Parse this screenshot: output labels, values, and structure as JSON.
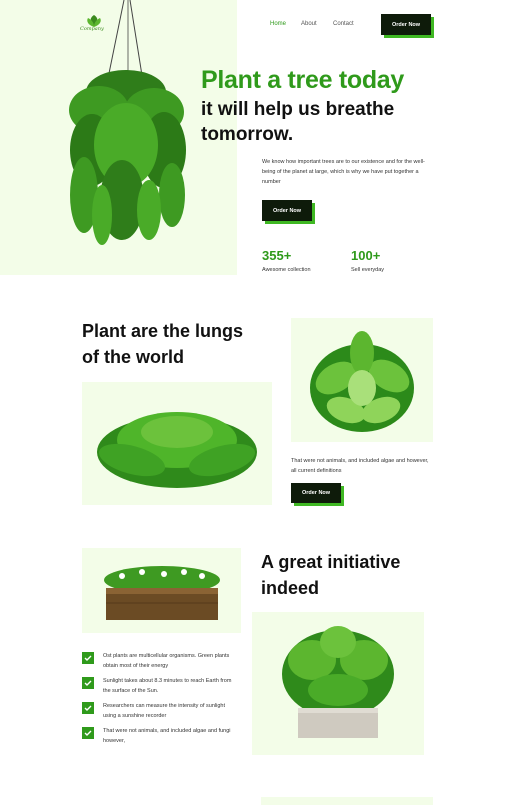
{
  "brand": {
    "logo_text": "Company"
  },
  "nav": {
    "home": "Home",
    "about": "About",
    "contact": "Contact",
    "cta": "Order Now"
  },
  "hero": {
    "title_highlight": "Plant a tree today",
    "title_rest": "it will help us breathe tomorrow.",
    "description": "We know how important trees are to our existence and for the well-being of the planet at large, which is why we have put together a number",
    "cta": "Order Now",
    "stats": [
      {
        "value": "355+",
        "label": "Awesome collection"
      },
      {
        "value": "100+",
        "label": "Sell everyday"
      }
    ]
  },
  "lungs": {
    "title": "Plant are the lungs of the world",
    "description": "That were not animals, and included algae and however, all current definitions",
    "cta": "Order Now"
  },
  "initiative": {
    "title": "A great initiative indeed",
    "items": [
      "Ost plants are multicellular organisms. Green plants obtain most of their energy",
      "Sunlight takes about 8.3 minutes to reach Earth from the surface of the Sun.",
      "Researchers can measure the intensity of sunlight using a sunshine recorder",
      "That were not animals, and included algae and fungi however,"
    ]
  },
  "colors": {
    "accent": "#2f9a1b",
    "dark": "#0e1b0a",
    "tint": "#f3fde8"
  }
}
